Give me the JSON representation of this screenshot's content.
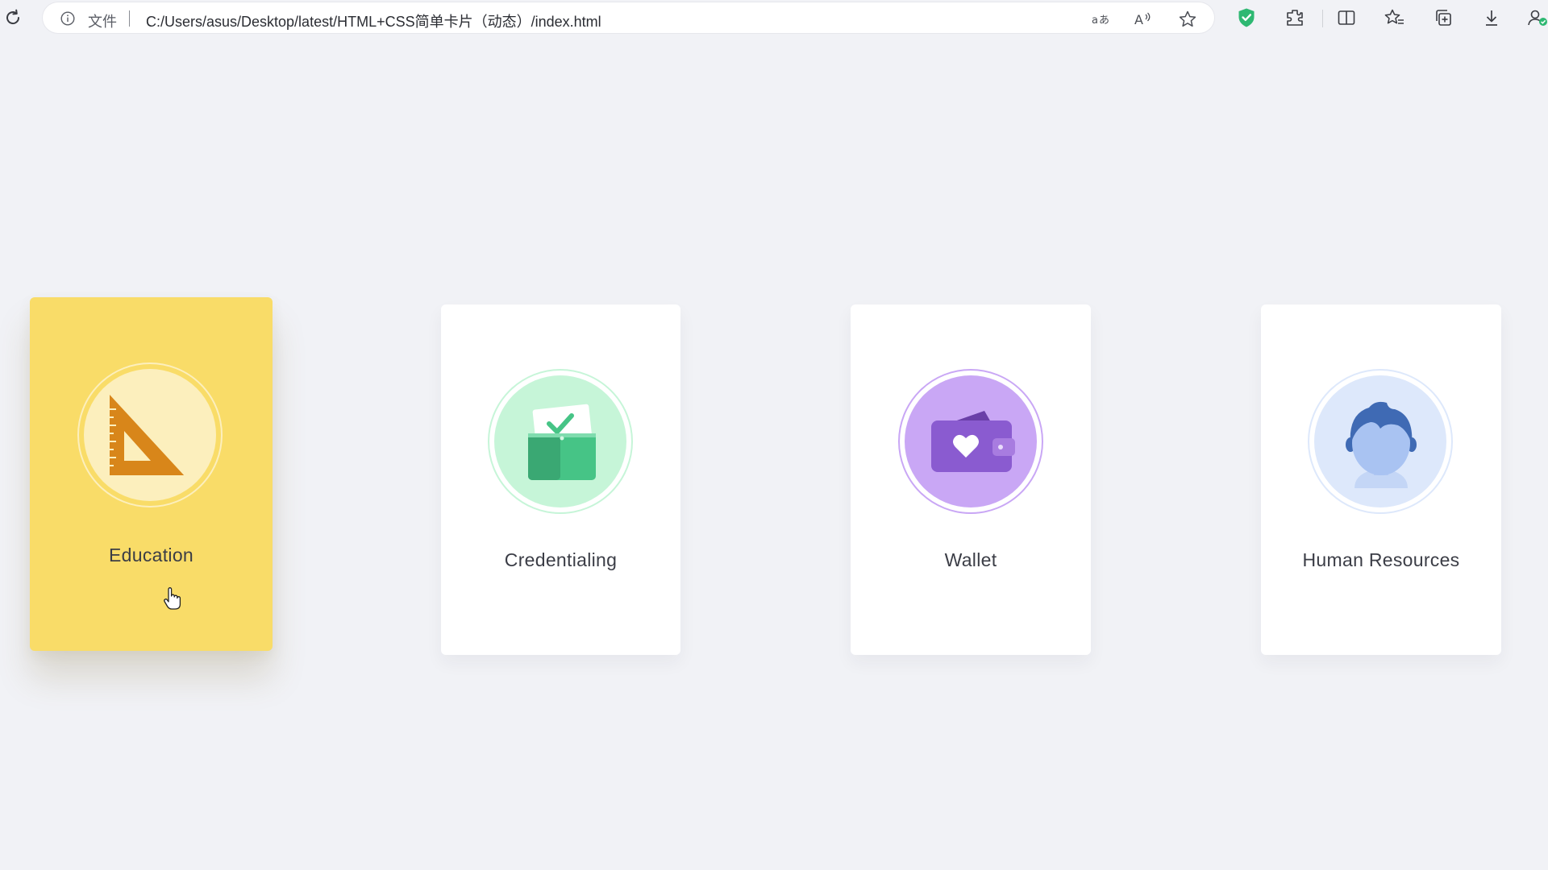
{
  "browser": {
    "reload_icon": "reload-icon",
    "info_icon": "info-icon",
    "scheme_label": "文件",
    "url": "C:/Users/asus/Desktop/latest/HTML+CSS简单卡片（动态）/index.html",
    "address_icons": [
      "translate-icon",
      "read-aloud-icon",
      "favorite-star-icon"
    ],
    "toolbar_icons": [
      "shield-extension-icon",
      "extensions-icon",
      "split-screen-icon",
      "favorites-icon",
      "collections-icon",
      "download-icon",
      "profile-icon"
    ],
    "accent_shield": "#2eb872"
  },
  "cards": [
    {
      "label": "Education",
      "icon": "set-square-icon",
      "active": true,
      "bg": "#f9dc68",
      "circle": "#fcefbd",
      "accent": "#d8861a"
    },
    {
      "label": "Credentialing",
      "icon": "wallet-check-icon",
      "active": false,
      "bg": "#ffffff",
      "circle": "#c6f5d8",
      "accent": "#46c486"
    },
    {
      "label": "Wallet",
      "icon": "wallet-heart-icon",
      "active": false,
      "bg": "#ffffff",
      "circle": "#c9a7f5",
      "accent": "#8a5bd0"
    },
    {
      "label": "Human Resources",
      "icon": "person-icon",
      "active": false,
      "bg": "#ffffff",
      "circle": "#dde8fb",
      "accent": "#3f6ab4"
    }
  ]
}
